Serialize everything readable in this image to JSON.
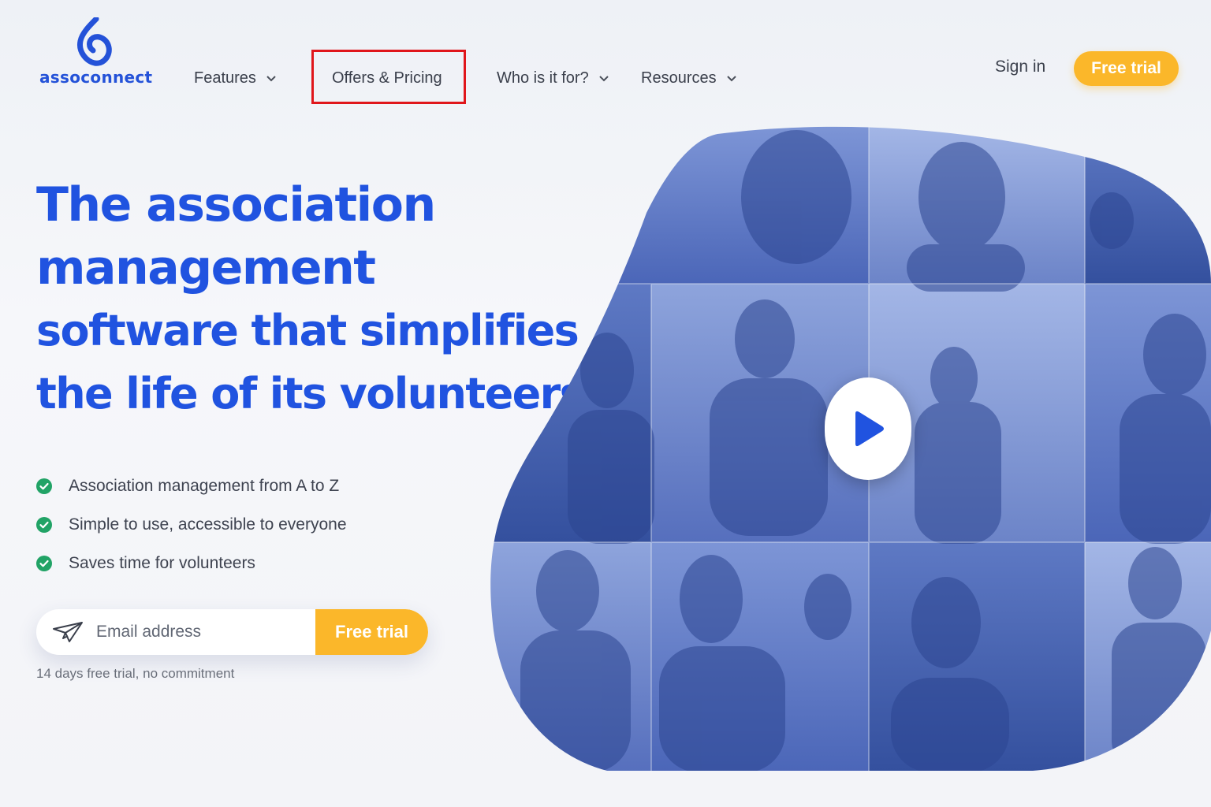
{
  "brand": {
    "name": "assoconnect",
    "color": "#2452d8",
    "logo_icon": "assoconnect-drop-logo"
  },
  "nav": {
    "items": [
      {
        "label": "Features",
        "has_dropdown": true
      },
      {
        "label": "Offers & Pricing",
        "has_dropdown": false,
        "highlighted": true
      },
      {
        "label": "Who is it for?",
        "has_dropdown": true
      },
      {
        "label": "Resources",
        "has_dropdown": true
      }
    ],
    "sign_in": "Sign in",
    "cta": "Free trial"
  },
  "hero": {
    "title_lines": [
      "The association",
      "management",
      "software that simplifies",
      "the life of its volunteers"
    ],
    "features": [
      "Association management from A to Z",
      "Simple to use, accessible to everyone",
      "Saves time for volunteers"
    ],
    "signup": {
      "placeholder": "Email address",
      "button": "Free trial",
      "note": "14 days free trial, no commitment"
    },
    "video": {
      "icon": "play-icon"
    }
  },
  "colors": {
    "accent_blue": "#2053e0",
    "cta_yellow": "#fbb72a",
    "check_green": "#21a366",
    "highlight_red": "#e0161b"
  }
}
